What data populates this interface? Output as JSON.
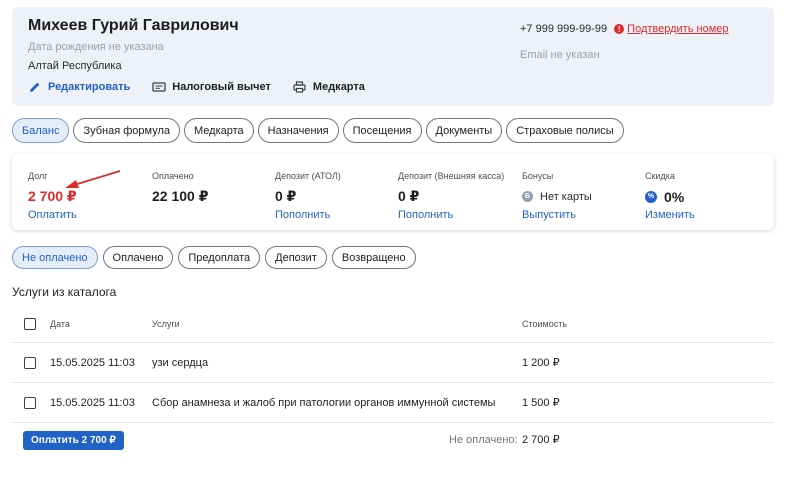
{
  "patient": {
    "name": "Михеев Гурий Гаврилович",
    "birth_date": "Дата рождения не указана",
    "region": "Алтай Республика",
    "phone": "+7 999 999-99-99",
    "alert_glyph": "!",
    "confirm_phone": "Подтвердить номер",
    "email": "Email не указан"
  },
  "actions": {
    "edit": "Редактировать",
    "tax": "Налоговый вычет",
    "medcard": "Медкарта"
  },
  "tabs": [
    {
      "label": "Баланс",
      "active": true
    },
    {
      "label": "Зубная формула"
    },
    {
      "label": "Медкарта"
    },
    {
      "label": "Назначения"
    },
    {
      "label": "Посещения"
    },
    {
      "label": "Документы"
    },
    {
      "label": "Страховые полисы"
    }
  ],
  "stats": {
    "debt": {
      "label": "Долг",
      "value": "2 700 ₽",
      "link": "Оплатить"
    },
    "paid": {
      "label": "Оплачено",
      "value": "22 100 ₽"
    },
    "deposit_atol": {
      "label": "Депозит (АТОЛ)",
      "value": "0 ₽",
      "link": "Пополнить"
    },
    "deposit_ext": {
      "label": "Депозит (Внешняя касса)",
      "value": "0 ₽",
      "link": "Пополнить"
    },
    "bonus": {
      "label": "Бонусы",
      "value": "Нет карты",
      "icon_glyph": "Б",
      "link": "Выпустить"
    },
    "discount": {
      "label": "Скидка",
      "value": "0%",
      "icon_glyph": "%",
      "link": "Изменить"
    }
  },
  "filters": [
    {
      "label": "Не оплачено",
      "active": true
    },
    {
      "label": "Оплачено"
    },
    {
      "label": "Предоплата"
    },
    {
      "label": "Депозит"
    },
    {
      "label": "Возвращено"
    }
  ],
  "services": {
    "title": "Услуги из каталога",
    "columns": {
      "date": "Дата",
      "service": "Услуги",
      "cost": "Стоимость"
    },
    "rows": [
      {
        "date": "15.05.2025 11:03",
        "service": "узи сердца",
        "cost": "1 200 ₽"
      },
      {
        "date": "15.05.2025 11:03",
        "service": "Сбор анамнеза и жалоб при патологии органов иммунной системы",
        "cost": "1 500 ₽"
      }
    ]
  },
  "footer": {
    "pay_button": "Оплатить 2 700 ₽",
    "unpaid_label": "Не оплачено:",
    "unpaid_total": "2 700 ₽"
  },
  "colors": {
    "accent": "#2162c7",
    "danger": "#e02b2b",
    "header_bg": "#eef2f8"
  },
  "icons": {
    "edit": "pencil-icon",
    "tax": "receipt-icon",
    "medcard": "printer-icon",
    "bonus": "bonus-card-icon",
    "discount": "percent-icon",
    "alert": "alert-icon",
    "annotation": "red-arrow-annotation"
  }
}
